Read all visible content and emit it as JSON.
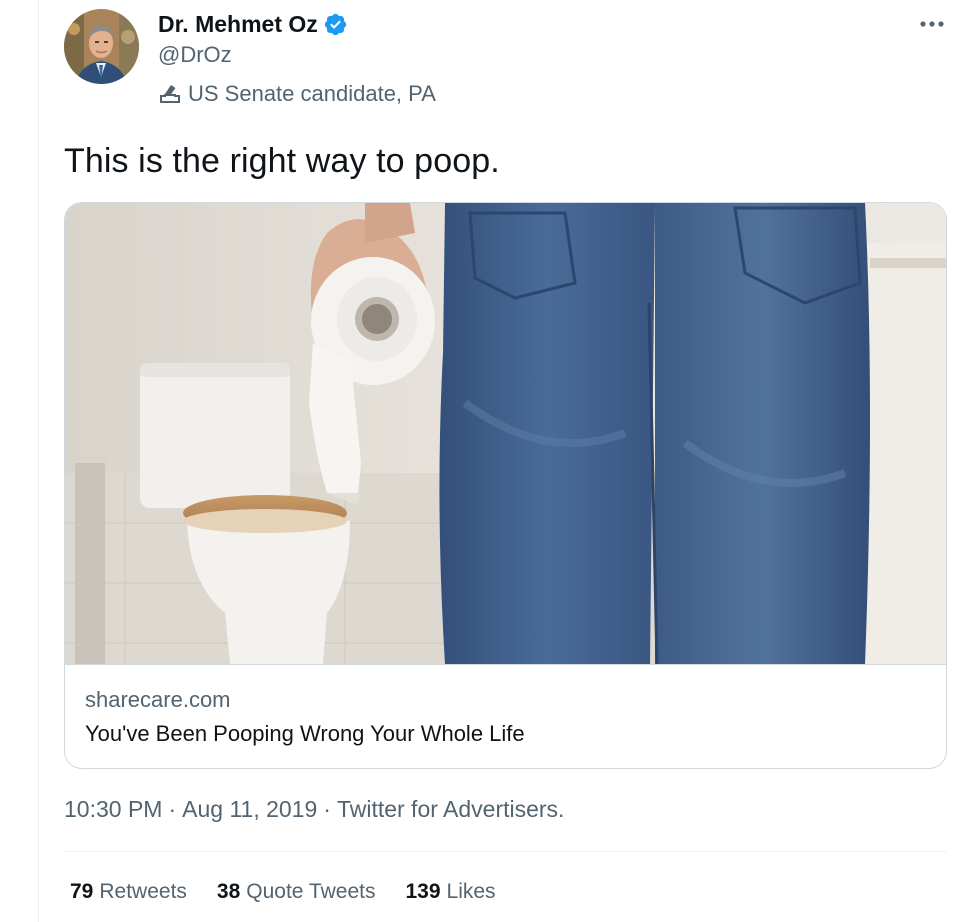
{
  "author": {
    "name": "Dr. Mehmet Oz",
    "handle": "@DrOz",
    "label": "US Senate candidate, PA",
    "verified": true
  },
  "tweet": {
    "text": "This is the right way to poop."
  },
  "card": {
    "domain": "sharecare.com",
    "title": "You've Been Pooping Wrong Your Whole Life"
  },
  "meta": {
    "time": "10:30 PM",
    "separator": "·",
    "date": "Aug 11, 2019",
    "source": "Twitter for Advertisers."
  },
  "stats": [
    {
      "count": "79",
      "label": "Retweets"
    },
    {
      "count": "38",
      "label": "Quote Tweets"
    },
    {
      "count": "139",
      "label": "Likes"
    }
  ],
  "colors": {
    "verified": "#1d9bf0",
    "secondary_text": "#536471",
    "primary_text": "#0f1419",
    "border": "#cfd9de"
  },
  "icons": {
    "verified": "verified-badge-icon",
    "label": "ballot-box-icon",
    "more": "more-horizontal-icon"
  }
}
